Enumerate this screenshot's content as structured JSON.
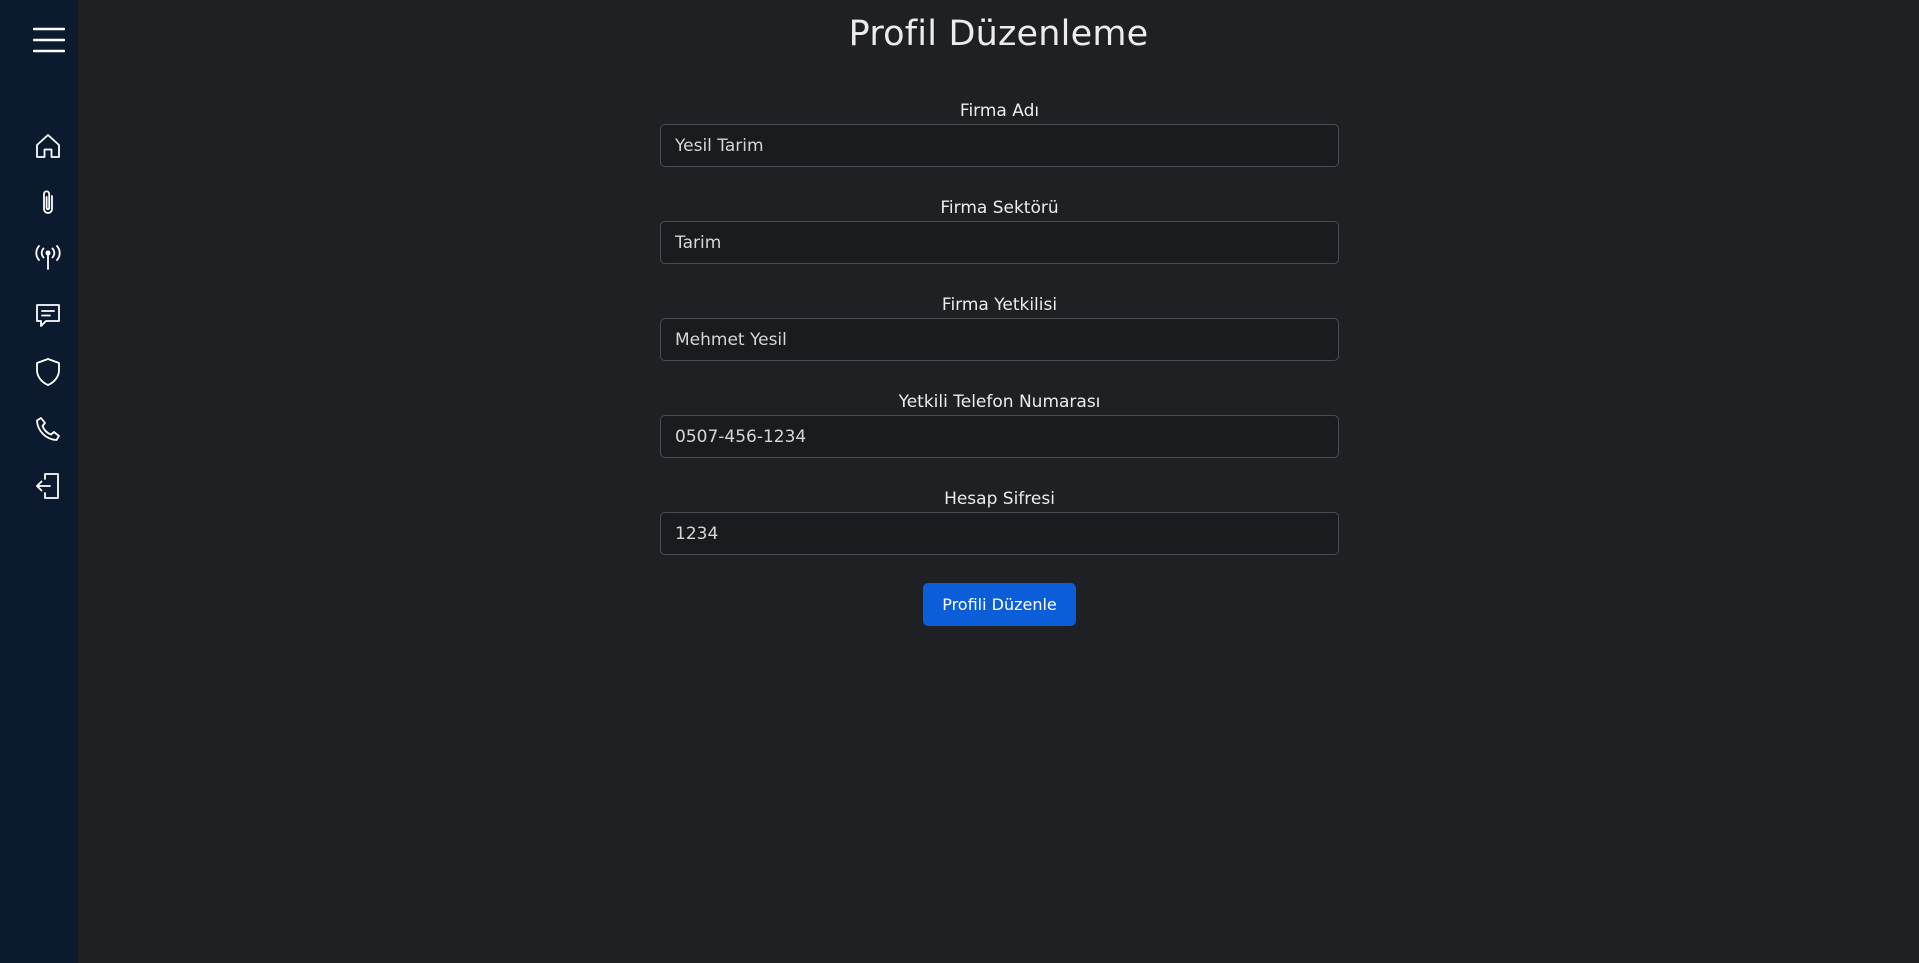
{
  "sidebar": {
    "menu_icon": "hamburger-menu-icon",
    "items": [
      {
        "id": "home",
        "icon": "home-icon"
      },
      {
        "id": "attachments",
        "icon": "paperclip-icon"
      },
      {
        "id": "broadcast",
        "icon": "antenna-icon"
      },
      {
        "id": "messages",
        "icon": "chat-icon"
      },
      {
        "id": "security",
        "icon": "shield-icon"
      },
      {
        "id": "contact",
        "icon": "phone-icon"
      },
      {
        "id": "logout",
        "icon": "logout-icon"
      }
    ]
  },
  "page": {
    "title": "Profil Düzenleme"
  },
  "form": {
    "fields": [
      {
        "label": "Firma Adı",
        "value": "Yesil Tarim"
      },
      {
        "label": "Firma Sektörü",
        "value": "Tarim"
      },
      {
        "label": "Firma Yetkilisi",
        "value": "Mehmet Yesil"
      },
      {
        "label": "Yetkili Telefon Numarası",
        "value": "0507-456-1234"
      },
      {
        "label": "Hesap Sifresi",
        "value": "1234"
      }
    ],
    "submit_label": "Profili Düzenle"
  },
  "colors": {
    "background": "#1f2023",
    "sidebar": "#0b1a2e",
    "accent": "#0b5ed7"
  }
}
